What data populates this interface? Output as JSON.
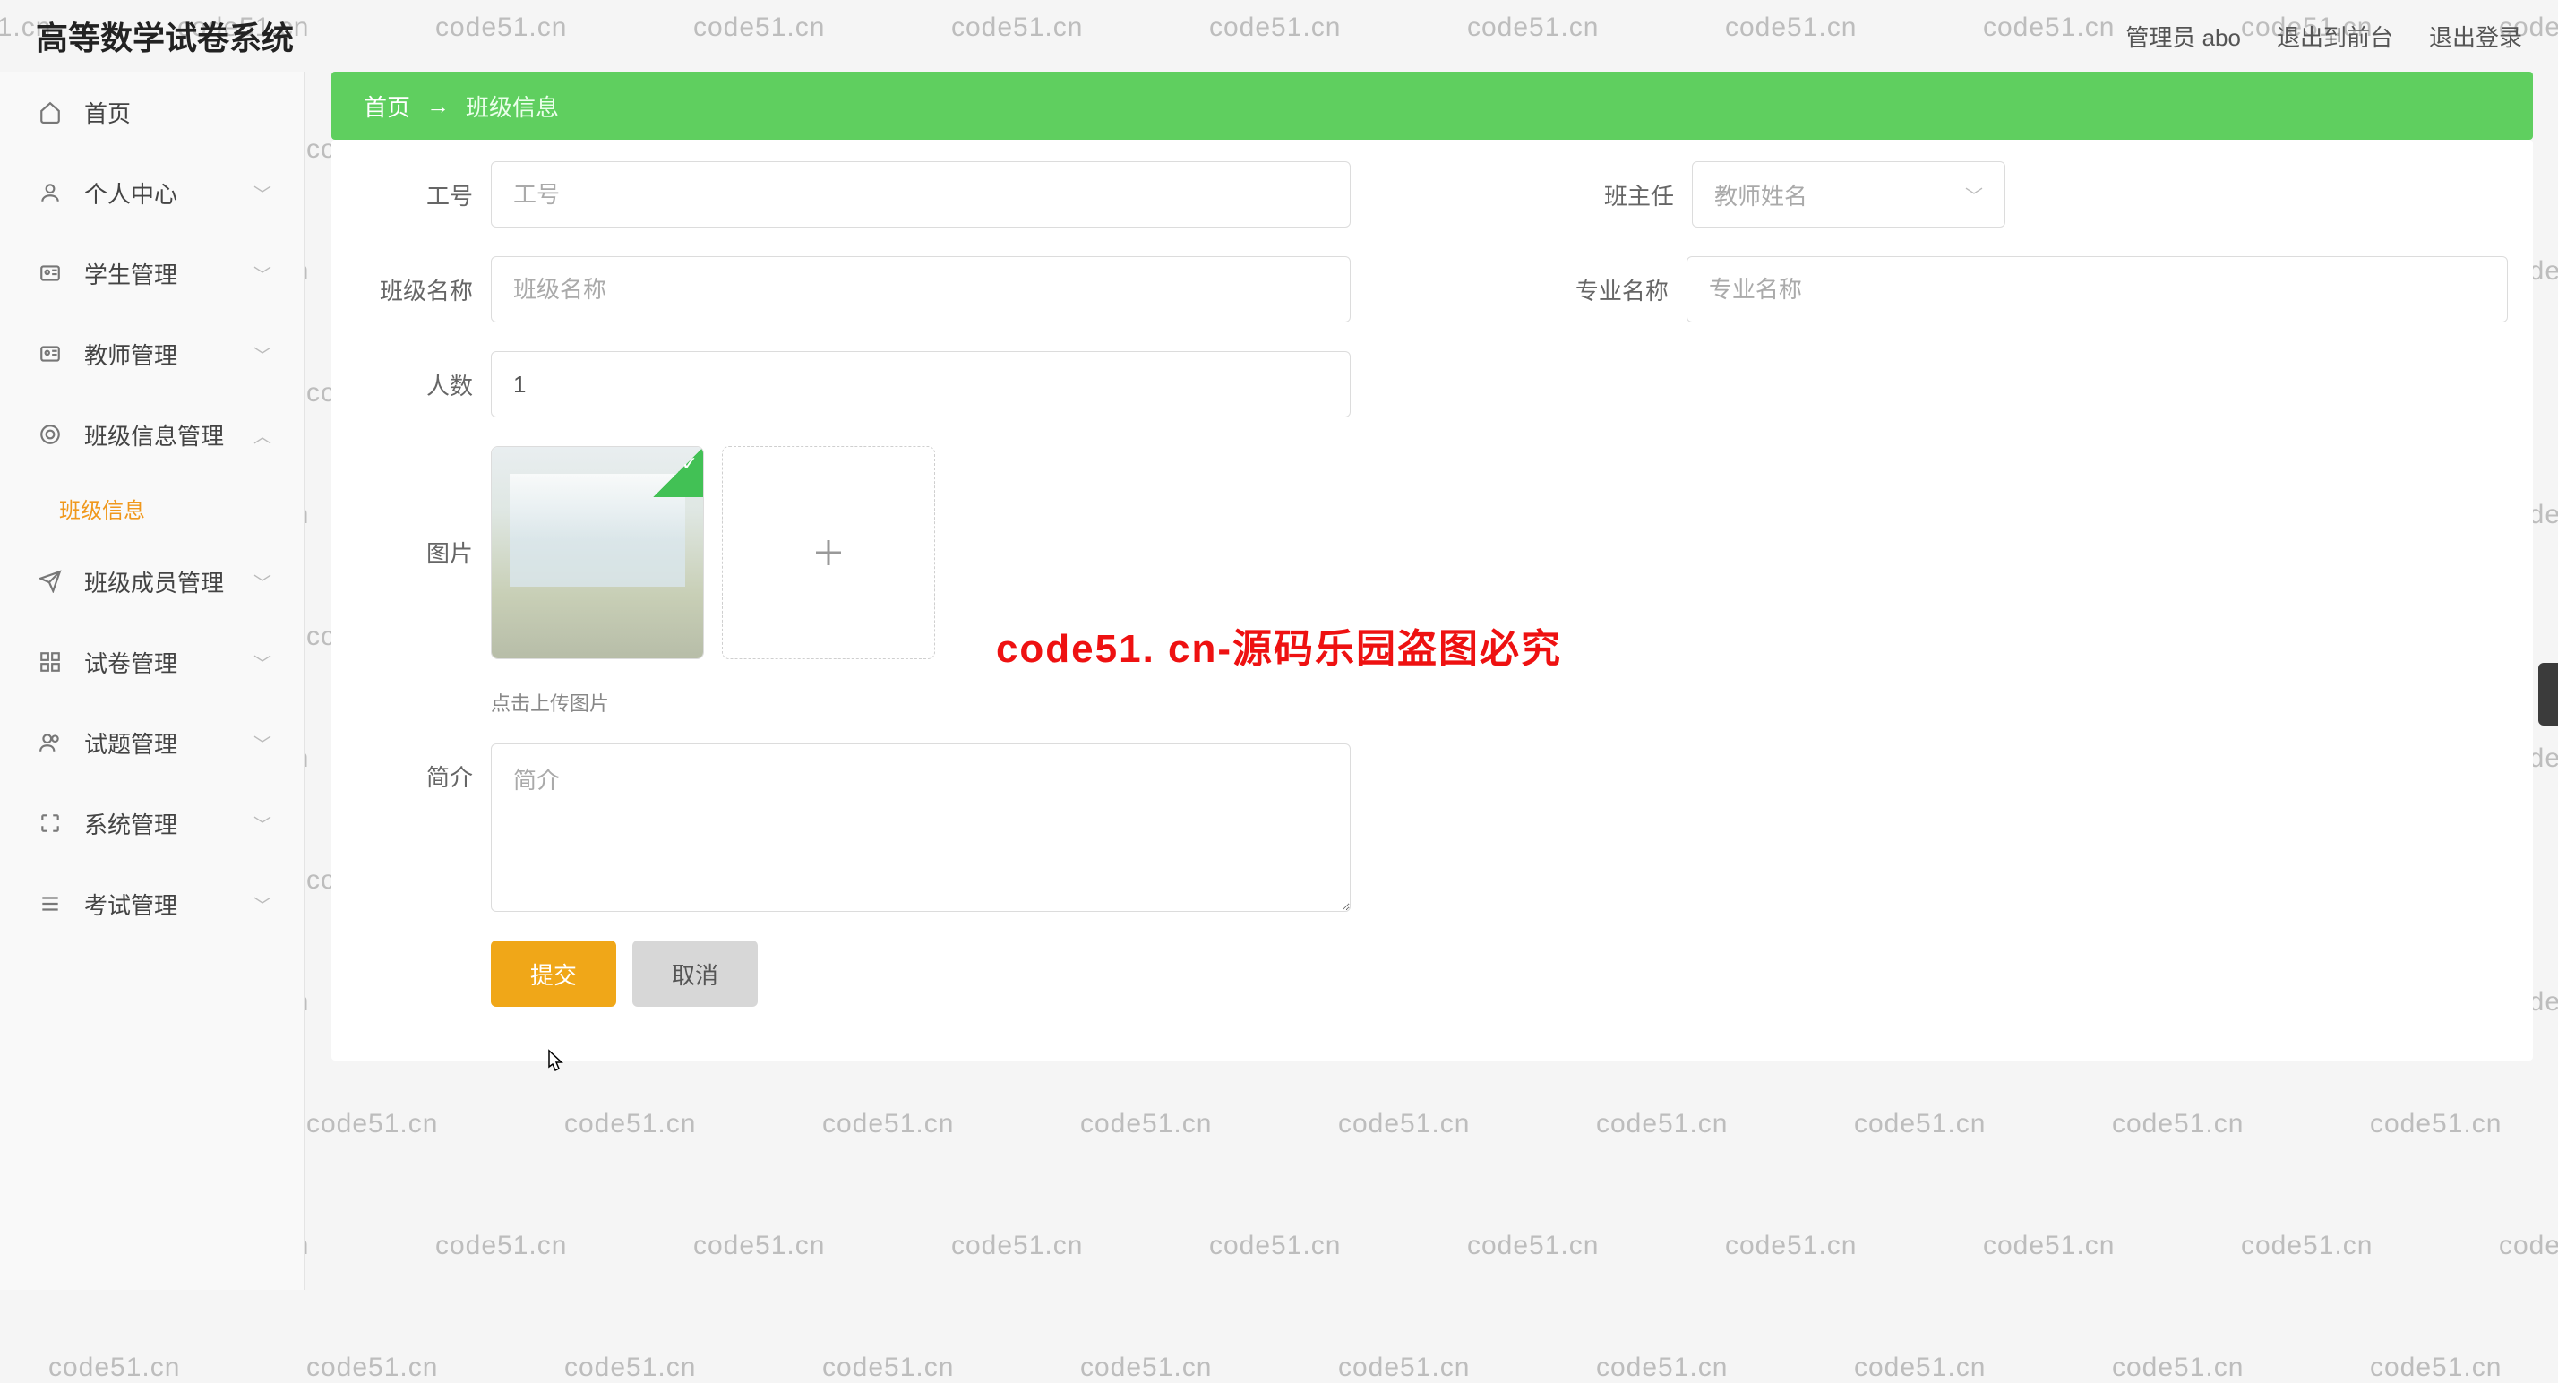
{
  "watermark_text": "code51.cn",
  "big_watermark": "code51. cn-源码乐园盗图必究",
  "header": {
    "app_title": "高等数学试卷系统",
    "admin_label": "管理员 abo",
    "exit_front": "退出到前台",
    "logout": "退出登录"
  },
  "sidebar": {
    "items": [
      {
        "icon": "home",
        "label": "首页",
        "has_children": false
      },
      {
        "icon": "user",
        "label": "个人中心",
        "has_children": true
      },
      {
        "icon": "card",
        "label": "学生管理",
        "has_children": true
      },
      {
        "icon": "card",
        "label": "教师管理",
        "has_children": true
      },
      {
        "icon": "target",
        "label": "班级信息管理",
        "has_children": true,
        "expanded": true,
        "children": [
          {
            "label": "班级信息"
          }
        ]
      },
      {
        "icon": "send",
        "label": "班级成员管理",
        "has_children": true
      },
      {
        "icon": "grid",
        "label": "试卷管理",
        "has_children": true
      },
      {
        "icon": "users",
        "label": "试题管理",
        "has_children": true
      },
      {
        "icon": "frame",
        "label": "系统管理",
        "has_children": true
      },
      {
        "icon": "bars",
        "label": "考试管理",
        "has_children": true
      }
    ]
  },
  "breadcrumb": {
    "root": "首页",
    "current": "班级信息"
  },
  "form": {
    "labels": {
      "gong_hao": "工号",
      "ban_zhu_ren": "班主任",
      "ban_ji_ming": "班级名称",
      "zhuan_ye": "专业名称",
      "ren_shu": "人数",
      "tu_pian": "图片",
      "jian_jie": "简介"
    },
    "placeholders": {
      "gong_hao": "工号",
      "ban_zhu_ren": "教师姓名",
      "ban_ji_ming": "班级名称",
      "zhuan_ye": "专业名称",
      "jian_jie": "简介"
    },
    "values": {
      "ren_shu": "1"
    },
    "upload_tip": "点击上传图片",
    "buttons": {
      "submit": "提交",
      "cancel": "取消"
    }
  }
}
